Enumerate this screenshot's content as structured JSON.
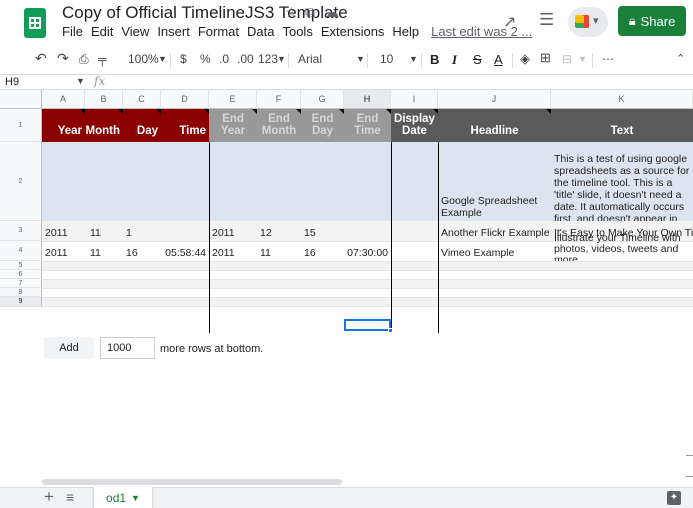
{
  "titlebar": {
    "doc_title": "Copy of Official TimelineJS3 Template",
    "star_icon": "☆",
    "move_icon": "⧉",
    "cloud_icon": "☁",
    "menus": [
      "File",
      "Edit",
      "View",
      "Insert",
      "Format",
      "Data",
      "Tools",
      "Extensions",
      "Help"
    ],
    "last_edit": "Last edit was 2 ...",
    "share_label": "Share",
    "share_color": "#188038"
  },
  "toolbar": {
    "zoom": "100%",
    "currency": "$",
    "percent": "%",
    "dec_less": ".0",
    "dec_more": ".00",
    "more_formats": "123",
    "font": "Arial",
    "font_size": "10",
    "bold": "B",
    "italic": "I",
    "strike": "S",
    "text_color": "A",
    "more": "⋯"
  },
  "formula_bar": {
    "name_box": "H9",
    "fx": "fx"
  },
  "columns": [
    "A",
    "B",
    "C",
    "D",
    "E",
    "F",
    "G",
    "H",
    "I",
    "J",
    "K"
  ],
  "rows": [
    "1",
    "2",
    "3",
    "4",
    "5",
    "6",
    "7",
    "8",
    "9"
  ],
  "header_row": [
    "Year",
    "Month",
    "Day",
    "Time",
    "End Year",
    "End Month",
    "End Day",
    "End Time",
    "Display Date",
    "Headline",
    "Text"
  ],
  "colors": {
    "header_red": "#8b0000",
    "header_gray": "#999999",
    "header_dark": "#5a5a5a",
    "title_row_blue": "#dbe5f1",
    "stripe": "#f3f3f3",
    "selection": "#1a73e8"
  },
  "data_rows": [
    {
      "row": "2",
      "cells": [
        "",
        "",
        "",
        "",
        "",
        "",
        "",
        "",
        "",
        "Google Spreadsheet Example",
        "This is a test of using google spreadsheets as a source for the timeline tool. This is a 'title' slide, it doesn't need a date. It automatically occurs first, and doesn't appear in the timeline bar."
      ]
    },
    {
      "row": "3",
      "cells": [
        "2011",
        "11",
        "1",
        "",
        "2011",
        "12",
        "15",
        "",
        "",
        "Another Flickr Example",
        "It's Easy to Make Your Own Timeline"
      ]
    },
    {
      "row": "4",
      "cells": [
        "2011",
        "11",
        "16",
        "05:58:44",
        "2011",
        "11",
        "16",
        "07:30:00",
        "",
        "Vimeo Example",
        "Illustrate your Timeline with photos, videos, tweets and more."
      ]
    }
  ],
  "add_rows": {
    "button": "Add",
    "count": "1000",
    "suffix": "more rows at bottom."
  },
  "sheets": {
    "tab": "od1",
    "add_icon": "+",
    "all_sheets_icon": "≡"
  }
}
